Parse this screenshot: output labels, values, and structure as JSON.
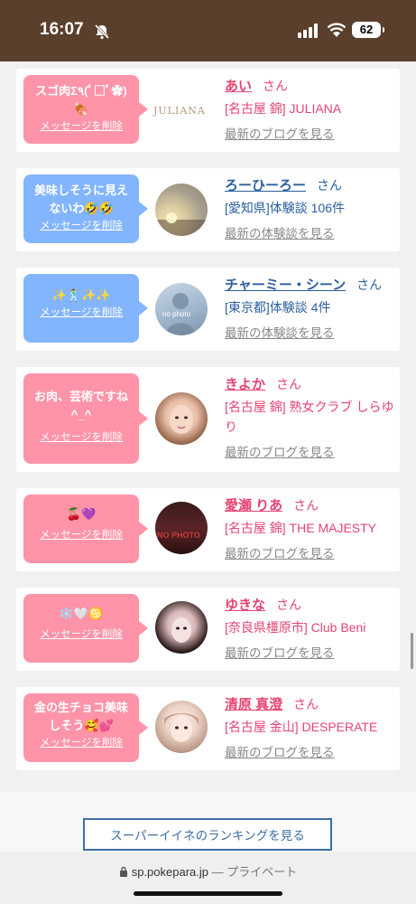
{
  "status": {
    "time": "16:07",
    "battery": "62"
  },
  "cards": [
    {
      "message": "スゴ肉Σ٩(ﾟ□ﾟ✿)🍖",
      "delete_label": "メッセージを削除",
      "name": "あい",
      "suffix": "さん",
      "shop": "[名古屋 錦] JULIANA",
      "link": "最新のブログを見る",
      "logo_text": "JULIANA"
    },
    {
      "message": "美味しそうに見えないわ🤣🤣",
      "delete_label": "メッセージを削除",
      "name": "ろーひーろー",
      "suffix": "さん",
      "shop": "[愛知県]体験談 106件",
      "link": "最新の体験談を見る"
    },
    {
      "message": "✨🕺✨✨",
      "delete_label": "メッセージを削除",
      "name": "チャーミー・シーン",
      "suffix": "さん",
      "shop": "[東京都]体験談 4件",
      "link": "最新の体験談を見る",
      "avatar_text": "no photo"
    },
    {
      "message": "お肉、芸術ですね^_^",
      "delete_label": "メッセージを削除",
      "name": "きよか",
      "suffix": "さん",
      "shop": "[名古屋 錦] 熟女クラブ しらゆり",
      "link": "最新のブログを見る"
    },
    {
      "message": "🍒💜",
      "delete_label": "メッセージを削除",
      "name": "愛瀬 りあ",
      "suffix": "さん",
      "shop": "[名古屋 錦] THE MAJESTY",
      "link": "最新のブログを見る",
      "avatar_text": "NO PHOTO"
    },
    {
      "message": "❄️🤍♋",
      "delete_label": "メッセージを削除",
      "name": "ゆきな",
      "suffix": "さん",
      "shop": "[奈良県橿原市] Club Beni",
      "link": "最新のブログを見る"
    },
    {
      "message": "金の生チョコ美味しそう🥰💕",
      "delete_label": "メッセージを削除",
      "name": "清原 真澄",
      "suffix": "さん",
      "shop": "[名古屋 金山] DESPERATE",
      "link": "最新のブログを見る"
    }
  ],
  "ranking_button": "スーパーイイネのランキングを見る",
  "url_bar": {
    "domain": "sp.pokepara.jp",
    "separator": "—",
    "mode": "プライベート"
  }
}
